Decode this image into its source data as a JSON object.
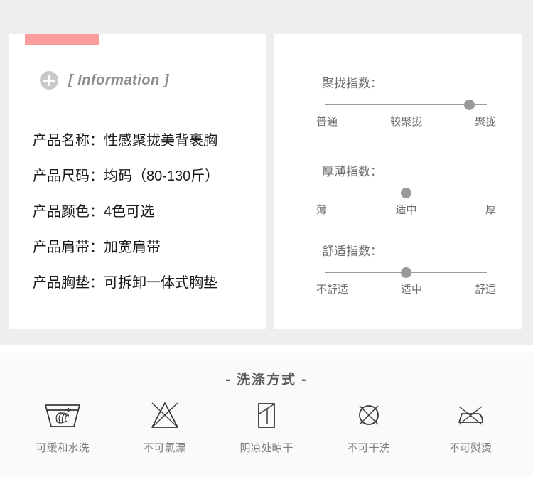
{
  "theme": {
    "band_background": "#eeeeee",
    "card_background": "#ffffff",
    "accent_pink": "#fa9d9d",
    "muted_text": "#6e6e6e",
    "care_background": "#fafafa"
  },
  "info_panel": {
    "icon": "plus-circle-icon",
    "title": "[ Information ]",
    "rows": [
      {
        "label": "产品名称：",
        "value": "性感聚拢美背裹胸"
      },
      {
        "label": "产品尺码：",
        "value": "均码（80-130斤）"
      },
      {
        "label": "产品颜色：",
        "value": "4色可选"
      },
      {
        "label": "产品肩带：",
        "value": "加宽肩带"
      },
      {
        "label": "产品胸垫：",
        "value": "可拆卸一体式胸垫"
      }
    ]
  },
  "index_panel": {
    "sliders": [
      {
        "title": "聚拢指数：",
        "value_percent": 89,
        "selected": "聚拢",
        "ticks": [
          "普通",
          "较聚拢",
          "聚拢"
        ]
      },
      {
        "title": "厚薄指数：",
        "value_percent": 50,
        "selected": "适中",
        "ticks": [
          "薄",
          "适中",
          "厚"
        ]
      },
      {
        "title": "舒适指数：",
        "value_percent": 50,
        "selected": "适中",
        "ticks": [
          "不舒适",
          "适中",
          "舒适"
        ]
      }
    ]
  },
  "care_section": {
    "title": "- 洗涤方式 -",
    "items": [
      {
        "icon": "gentle-wash-tub-icon",
        "label": "可缓和水洗"
      },
      {
        "icon": "no-chlorine-bleach-triangle-icon",
        "label": "不可氯漂"
      },
      {
        "icon": "dry-in-shade-square-icon",
        "label": "阴凉处晾干"
      },
      {
        "icon": "no-dry-clean-circle-icon",
        "label": "不可干洗"
      },
      {
        "icon": "no-iron-icon",
        "label": "不可熨烫"
      }
    ]
  }
}
